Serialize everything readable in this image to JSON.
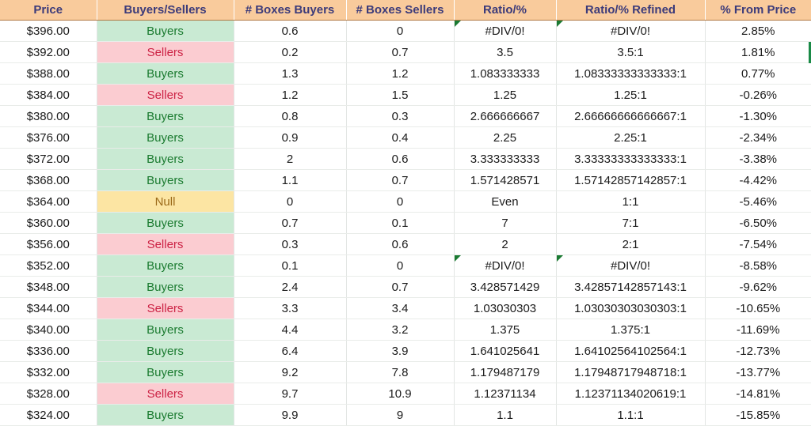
{
  "sheet": {
    "columns": [
      {
        "key": "price",
        "label": "Price"
      },
      {
        "key": "side",
        "label": "Buyers/Sellers"
      },
      {
        "key": "boxbuy",
        "label": "# Boxes Buyers"
      },
      {
        "key": "boxsell",
        "label": "# Boxes Sellers"
      },
      {
        "key": "ratio",
        "label": "Ratio/%"
      },
      {
        "key": "ratioref",
        "label": "Ratio/% Refined"
      },
      {
        "key": "fromprice",
        "label": "% From Price"
      }
    ],
    "colors": {
      "header_bg": "#F9CB9C",
      "header_text": "#3C3B7A",
      "buyers_bg": "#C9EAD3",
      "buyers_text": "#1B7B30",
      "sellers_bg": "#FBCCD1",
      "sellers_text": "#CC2244",
      "null_bg": "#FCE5A3",
      "null_text": "#9C6B1A",
      "error_flag": "#1A7A32",
      "selection_border": "#1A8A47",
      "gridline": "#E3E6E4"
    },
    "selection": {
      "row_index": 1,
      "column": "fromprice"
    },
    "rows": [
      {
        "price": "$396.00",
        "side": "Buyers",
        "side_state": "buyers",
        "boxbuy": "0.6",
        "boxsell": "0",
        "ratio": "#DIV/0!",
        "ratio_error": true,
        "ratioref": "#DIV/0!",
        "ratioref_error": true,
        "fromprice": "2.85%"
      },
      {
        "price": "$392.00",
        "side": "Sellers",
        "side_state": "sellers",
        "boxbuy": "0.2",
        "boxsell": "0.7",
        "ratio": "3.5",
        "ratio_error": false,
        "ratioref": "3.5:1",
        "ratioref_error": false,
        "fromprice": "1.81%"
      },
      {
        "price": "$388.00",
        "side": "Buyers",
        "side_state": "buyers",
        "boxbuy": "1.3",
        "boxsell": "1.2",
        "ratio": "1.083333333",
        "ratio_error": false,
        "ratioref": "1.08333333333333:1",
        "ratioref_error": false,
        "fromprice": "0.77%"
      },
      {
        "price": "$384.00",
        "side": "Sellers",
        "side_state": "sellers",
        "boxbuy": "1.2",
        "boxsell": "1.5",
        "ratio": "1.25",
        "ratio_error": false,
        "ratioref": "1.25:1",
        "ratioref_error": false,
        "fromprice": "-0.26%"
      },
      {
        "price": "$380.00",
        "side": "Buyers",
        "side_state": "buyers",
        "boxbuy": "0.8",
        "boxsell": "0.3",
        "ratio": "2.666666667",
        "ratio_error": false,
        "ratioref": "2.66666666666667:1",
        "ratioref_error": false,
        "fromprice": "-1.30%"
      },
      {
        "price": "$376.00",
        "side": "Buyers",
        "side_state": "buyers",
        "boxbuy": "0.9",
        "boxsell": "0.4",
        "ratio": "2.25",
        "ratio_error": false,
        "ratioref": "2.25:1",
        "ratioref_error": false,
        "fromprice": "-2.34%"
      },
      {
        "price": "$372.00",
        "side": "Buyers",
        "side_state": "buyers",
        "boxbuy": "2",
        "boxsell": "0.6",
        "ratio": "3.333333333",
        "ratio_error": false,
        "ratioref": "3.33333333333333:1",
        "ratioref_error": false,
        "fromprice": "-3.38%"
      },
      {
        "price": "$368.00",
        "side": "Buyers",
        "side_state": "buyers",
        "boxbuy": "1.1",
        "boxsell": "0.7",
        "ratio": "1.571428571",
        "ratio_error": false,
        "ratioref": "1.57142857142857:1",
        "ratioref_error": false,
        "fromprice": "-4.42%"
      },
      {
        "price": "$364.00",
        "side": "Null",
        "side_state": "null",
        "boxbuy": "0",
        "boxsell": "0",
        "ratio": "Even",
        "ratio_error": false,
        "ratioref": "1:1",
        "ratioref_error": false,
        "fromprice": "-5.46%"
      },
      {
        "price": "$360.00",
        "side": "Buyers",
        "side_state": "buyers",
        "boxbuy": "0.7",
        "boxsell": "0.1",
        "ratio": "7",
        "ratio_error": false,
        "ratioref": "7:1",
        "ratioref_error": false,
        "fromprice": "-6.50%"
      },
      {
        "price": "$356.00",
        "side": "Sellers",
        "side_state": "sellers",
        "boxbuy": "0.3",
        "boxsell": "0.6",
        "ratio": "2",
        "ratio_error": false,
        "ratioref": "2:1",
        "ratioref_error": false,
        "fromprice": "-7.54%"
      },
      {
        "price": "$352.00",
        "side": "Buyers",
        "side_state": "buyers",
        "boxbuy": "0.1",
        "boxsell": "0",
        "ratio": "#DIV/0!",
        "ratio_error": true,
        "ratioref": "#DIV/0!",
        "ratioref_error": true,
        "fromprice": "-8.58%"
      },
      {
        "price": "$348.00",
        "side": "Buyers",
        "side_state": "buyers",
        "boxbuy": "2.4",
        "boxsell": "0.7",
        "ratio": "3.428571429",
        "ratio_error": false,
        "ratioref": "3.42857142857143:1",
        "ratioref_error": false,
        "fromprice": "-9.62%"
      },
      {
        "price": "$344.00",
        "side": "Sellers",
        "side_state": "sellers",
        "boxbuy": "3.3",
        "boxsell": "3.4",
        "ratio": "1.03030303",
        "ratio_error": false,
        "ratioref": "1.03030303030303:1",
        "ratioref_error": false,
        "fromprice": "-10.65%"
      },
      {
        "price": "$340.00",
        "side": "Buyers",
        "side_state": "buyers",
        "boxbuy": "4.4",
        "boxsell": "3.2",
        "ratio": "1.375",
        "ratio_error": false,
        "ratioref": "1.375:1",
        "ratioref_error": false,
        "fromprice": "-11.69%"
      },
      {
        "price": "$336.00",
        "side": "Buyers",
        "side_state": "buyers",
        "boxbuy": "6.4",
        "boxsell": "3.9",
        "ratio": "1.641025641",
        "ratio_error": false,
        "ratioref": "1.64102564102564:1",
        "ratioref_error": false,
        "fromprice": "-12.73%"
      },
      {
        "price": "$332.00",
        "side": "Buyers",
        "side_state": "buyers",
        "boxbuy": "9.2",
        "boxsell": "7.8",
        "ratio": "1.179487179",
        "ratio_error": false,
        "ratioref": "1.17948717948718:1",
        "ratioref_error": false,
        "fromprice": "-13.77%"
      },
      {
        "price": "$328.00",
        "side": "Sellers",
        "side_state": "sellers",
        "boxbuy": "9.7",
        "boxsell": "10.9",
        "ratio": "1.12371134",
        "ratio_error": false,
        "ratioref": "1.12371134020619:1",
        "ratioref_error": false,
        "fromprice": "-14.81%"
      },
      {
        "price": "$324.00",
        "side": "Buyers",
        "side_state": "buyers",
        "boxbuy": "9.9",
        "boxsell": "9",
        "ratio": "1.1",
        "ratio_error": false,
        "ratioref": "1.1:1",
        "ratioref_error": false,
        "fromprice": "-15.85%"
      }
    ]
  }
}
